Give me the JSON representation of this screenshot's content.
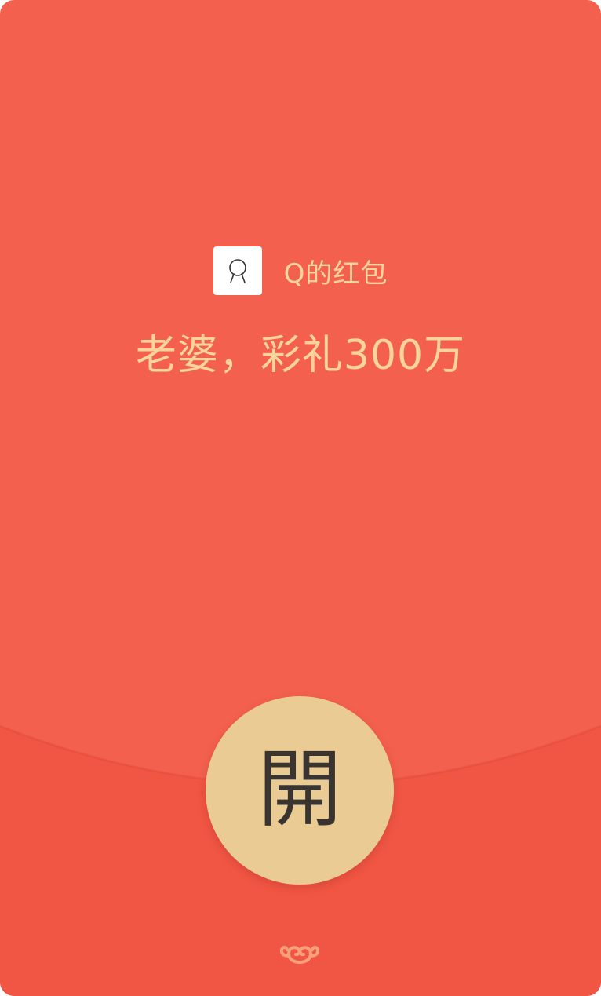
{
  "envelope": {
    "sender_name": "Q的红包",
    "greeting": "老婆，彩礼300万",
    "open_label": "開"
  },
  "icons": {
    "avatar": "default-avatar-icon",
    "logo": "auspicious-cloud-icon"
  },
  "colors": {
    "envelope_top": "#f4604e",
    "envelope_bottom": "#f15544",
    "text_gold": "#f6d49c",
    "button_gold": "#eacb94",
    "button_text": "#3a3430"
  }
}
